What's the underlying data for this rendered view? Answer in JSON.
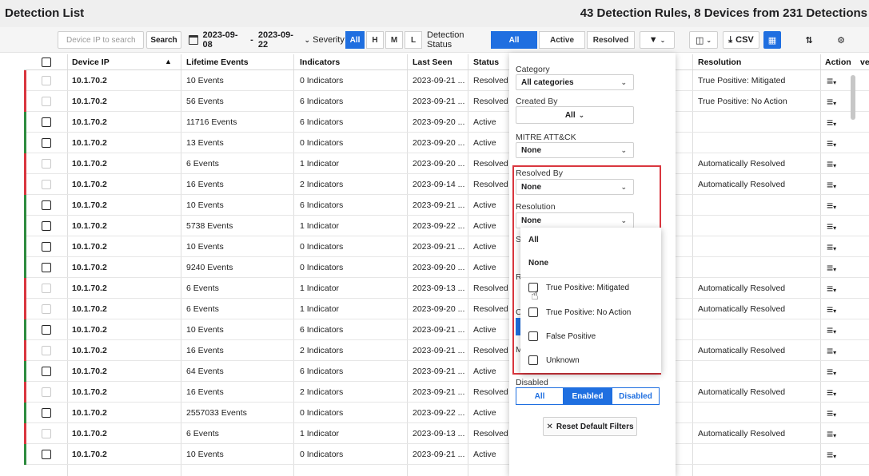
{
  "header": {
    "title": "Detection List",
    "summary": "43 Detection Rules, 8 Devices from 231 Detections"
  },
  "toolbar": {
    "ip_placeholder": "Device IP to search",
    "search_label": "Search",
    "date_from": "2023-09-08",
    "date_sep": "-",
    "date_to": "2023-09-22",
    "severity_label": "Severity",
    "severity_options": [
      "All",
      "H",
      "M",
      "L"
    ],
    "status_label": "Detection Status",
    "status_options": [
      "All",
      "Active",
      "Resolved"
    ],
    "csv_label": "CSV"
  },
  "columns": {
    "ip": "Device IP",
    "events": "Lifetime Events",
    "indicators": "Indicators",
    "last_seen": "Last Seen",
    "status": "Status",
    "resolution": "Resolution",
    "action": "Action",
    "extra": "ve"
  },
  "rows": [
    {
      "ip": "10.1.70.2",
      "events": "10 Events",
      "indicators": "0 Indicators",
      "last_seen": "2023-09-21 ...",
      "status": "Resolved",
      "resolution": "True Positive: Mitigated",
      "bar": "#d9363e"
    },
    {
      "ip": "10.1.70.2",
      "events": "56 Events",
      "indicators": "6 Indicators",
      "last_seen": "2023-09-21 ...",
      "status": "Resolved",
      "resolution": "True Positive: No Action",
      "bar": "#d9363e"
    },
    {
      "ip": "10.1.70.2",
      "events": "11716 Events",
      "indicators": "6 Indicators",
      "last_seen": "2023-09-20 ...",
      "status": "Active",
      "resolution": "",
      "bar": "#2e8b3e"
    },
    {
      "ip": "10.1.70.2",
      "events": "13 Events",
      "indicators": "0 Indicators",
      "last_seen": "2023-09-20 ...",
      "status": "Active",
      "resolution": "",
      "bar": "#2e8b3e"
    },
    {
      "ip": "10.1.70.2",
      "events": "6 Events",
      "indicators": "1 Indicator",
      "last_seen": "2023-09-20 ...",
      "status": "Resolved",
      "resolution": "Automatically Resolved",
      "bar": "#d9363e"
    },
    {
      "ip": "10.1.70.2",
      "events": "16 Events",
      "indicators": "2 Indicators",
      "last_seen": "2023-09-14 ...",
      "status": "Resolved",
      "resolution": "Automatically Resolved",
      "bar": "#d9363e"
    },
    {
      "ip": "10.1.70.2",
      "events": "10 Events",
      "indicators": "6 Indicators",
      "last_seen": "2023-09-21 ...",
      "status": "Active",
      "resolution": "",
      "bar": "#2e8b3e"
    },
    {
      "ip": "10.1.70.2",
      "events": "5738 Events",
      "indicators": "1 Indicator",
      "last_seen": "2023-09-22 ...",
      "status": "Active",
      "resolution": "",
      "bar": "#2e8b3e"
    },
    {
      "ip": "10.1.70.2",
      "events": "10 Events",
      "indicators": "0 Indicators",
      "last_seen": "2023-09-21 ...",
      "status": "Active",
      "resolution": "",
      "bar": "#2e8b3e"
    },
    {
      "ip": "10.1.70.2",
      "events": "9240 Events",
      "indicators": "0 Indicators",
      "last_seen": "2023-09-20 ...",
      "status": "Active",
      "resolution": "",
      "bar": "#2e8b3e"
    },
    {
      "ip": "10.1.70.2",
      "events": "6 Events",
      "indicators": "1 Indicator",
      "last_seen": "2023-09-13 ...",
      "status": "Resolved",
      "resolution": "Automatically Resolved",
      "bar": "#d9363e"
    },
    {
      "ip": "10.1.70.2",
      "events": "6 Events",
      "indicators": "1 Indicator",
      "last_seen": "2023-09-20 ...",
      "status": "Resolved",
      "resolution": "Automatically Resolved",
      "bar": "#d9363e"
    },
    {
      "ip": "10.1.70.2",
      "events": "10 Events",
      "indicators": "6 Indicators",
      "last_seen": "2023-09-21 ...",
      "status": "Active",
      "resolution": "",
      "bar": "#2e8b3e"
    },
    {
      "ip": "10.1.70.2",
      "events": "16 Events",
      "indicators": "2 Indicators",
      "last_seen": "2023-09-21 ...",
      "status": "Resolved",
      "resolution": "Automatically Resolved",
      "bar": "#d9363e"
    },
    {
      "ip": "10.1.70.2",
      "events": "64 Events",
      "indicators": "6 Indicators",
      "last_seen": "2023-09-21 ...",
      "status": "Active",
      "resolution": "",
      "bar": "#2e8b3e"
    },
    {
      "ip": "10.1.70.2",
      "events": "16 Events",
      "indicators": "2 Indicators",
      "last_seen": "2023-09-21 ...",
      "status": "Resolved",
      "resolution": "Automatically Resolved",
      "bar": "#d9363e"
    },
    {
      "ip": "10.1.70.2",
      "events": "2557033 Events",
      "indicators": "0 Indicators",
      "last_seen": "2023-09-22 ...",
      "status": "Active",
      "resolution": "",
      "bar": "#2e8b3e"
    },
    {
      "ip": "10.1.70.2",
      "events": "6 Events",
      "indicators": "1 Indicator",
      "last_seen": "2023-09-13 ...",
      "status": "Resolved",
      "resolution": "Automatically Resolved",
      "bar": "#d9363e"
    },
    {
      "ip": "10.1.70.2",
      "events": "10 Events",
      "indicators": "0 Indicators",
      "last_seen": "2023-09-21 ...",
      "status": "Active",
      "resolution": "",
      "bar": "#2e8b3e"
    }
  ],
  "filter_panel": {
    "category_label": "Category",
    "category_value": "All categories",
    "created_by_label": "Created By",
    "created_by_value": "All",
    "mitre_label": "MITRE ATT&CK",
    "mitre_value": "None",
    "resolved_by_label": "Resolved By",
    "resolved_by_value": "None",
    "resolution_label": "Resolution",
    "resolution_value": "None",
    "resolution_options": {
      "all": "All",
      "none": "None",
      "tp_mitigated": "True Positive: Mitigated",
      "tp_no_action": "True Positive: No Action",
      "false_positive": "False Positive",
      "unknown": "Unknown"
    },
    "hidden_fragments": {
      "s": "S",
      "r": "R",
      "c": "C",
      "m": "M"
    },
    "disabled_label": "Disabled",
    "disabled_options": {
      "all": "All",
      "enabled": "Enabled",
      "disabled": "Disabled"
    },
    "reset_label": "Reset Default Filters"
  },
  "colors": {
    "accent": "#1f6fe0",
    "resolved_bar": "#d9363e",
    "active_bar": "#2e8b3e",
    "highlight": "#d9363e"
  }
}
